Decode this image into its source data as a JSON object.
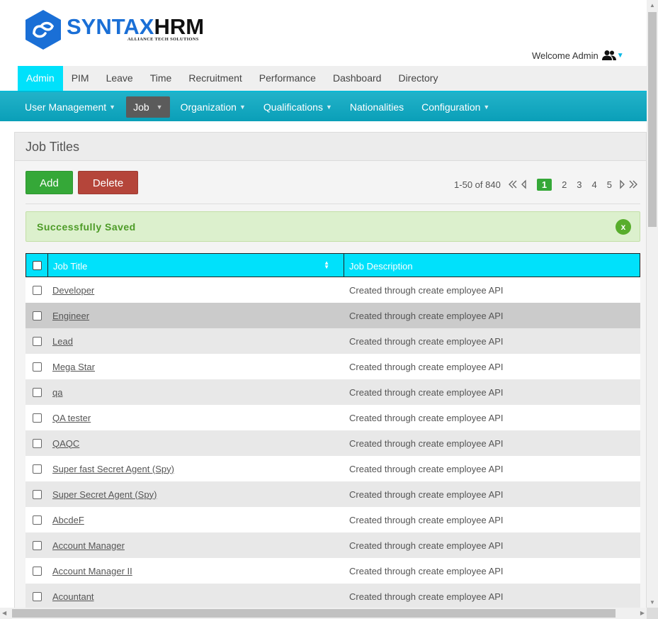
{
  "header": {
    "logo_main": "SYNTAX",
    "logo_accent": "HRM",
    "logo_tagline": "ALLIANCE TECH SOLUTIONS",
    "welcome": "Welcome Admin",
    "user_icon": "users-icon"
  },
  "top_menu": [
    "Admin",
    "PIM",
    "Leave",
    "Time",
    "Recruitment",
    "Performance",
    "Dashboard",
    "Directory"
  ],
  "sub_menu": [
    {
      "label": "User Management",
      "dropdown": true
    },
    {
      "label": "Job",
      "dropdown": true
    },
    {
      "label": "Organization",
      "dropdown": true
    },
    {
      "label": "Qualifications",
      "dropdown": true
    },
    {
      "label": "Nationalities",
      "dropdown": false
    },
    {
      "label": "Configuration",
      "dropdown": true
    }
  ],
  "panel": {
    "title": "Job Titles",
    "add_label": "Add",
    "delete_label": "Delete",
    "pagination": {
      "range_text": "1-50 of 840",
      "pages": [
        "1",
        "2",
        "3",
        "4",
        "5"
      ],
      "current_page": "1"
    },
    "alert": "Successfully Saved",
    "alert_close": "x"
  },
  "table": {
    "headers": [
      "Job Title",
      "Job Description"
    ],
    "rows": [
      {
        "title": "Developer",
        "description": "Created through create employee API"
      },
      {
        "title": "Engineer",
        "description": "Created through create employee API"
      },
      {
        "title": "Lead",
        "description": "Created through create employee API"
      },
      {
        "title": "Mega Star",
        "description": "Created through create employee API"
      },
      {
        "title": "qa",
        "description": "Created through create employee API"
      },
      {
        "title": "QA tester",
        "description": "Created through create employee API"
      },
      {
        "title": "QAQC",
        "description": "Created through create employee API"
      },
      {
        "title": "Super fast Secret Agent (Spy)",
        "description": "Created through create employee API"
      },
      {
        "title": "Super Secret Agent (Spy)",
        "description": "Created through create employee API"
      },
      {
        "title": "AbcdeF",
        "description": "Created through create employee API"
      },
      {
        "title": "Account Manager",
        "description": "Created through create employee API"
      },
      {
        "title": "Account Manager II",
        "description": "Created through create employee API"
      },
      {
        "title": "Acountant",
        "description": "Created through create employee API"
      }
    ]
  },
  "colors": {
    "accent": "#00e1fb",
    "submenu": "#15a8c0",
    "add": "#35a838",
    "delete": "#b5453a",
    "success_bg": "#dcf0cd",
    "row_alt": "#e8e8e8",
    "row_highlight": "#cbcbcb"
  }
}
